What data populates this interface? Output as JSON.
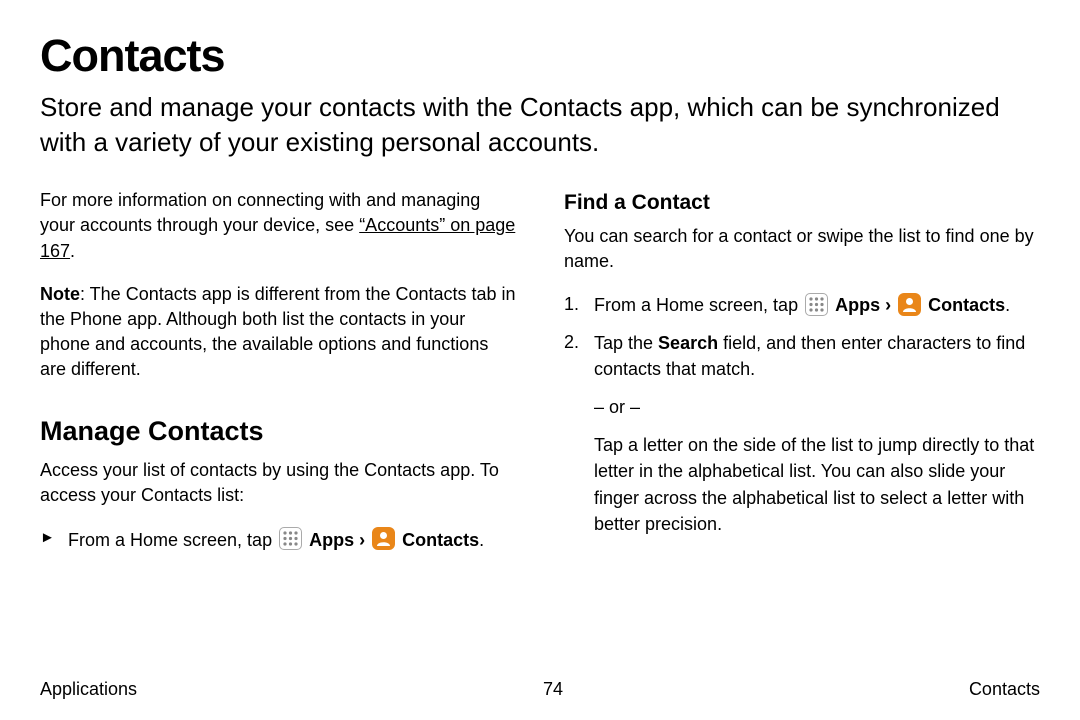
{
  "title": "Contacts",
  "intro": "Store and manage your contacts with the Contacts app, which can be synchronized with a variety of your existing personal accounts.",
  "left": {
    "info_prefix": "For more information on connecting with and managing your accounts through your device, see ",
    "info_link": "“Accounts” on page 167",
    "info_suffix": ".",
    "note_label": "Note",
    "note_body": ": The Contacts app is different from the Contacts tab in the Phone app. Although both list the contacts in your phone and accounts, the available options and functions are different.",
    "manage_heading": "Manage Contacts",
    "manage_body": "Access your list of contacts by using the Contacts app. To access your Contacts list:",
    "step_bullet": "►",
    "step_prefix": "From a Home screen, tap ",
    "apps_label": "Apps",
    "sep": " › ",
    "contacts_label": "Contacts",
    "period": "."
  },
  "right": {
    "find_heading": "Find a Contact",
    "find_body": "You can search for a contact or swipe the list to find one by name.",
    "step1_num": "1.",
    "step1_prefix": "From a Home screen, tap ",
    "step2_num": "2.",
    "step2_a": "Tap the ",
    "step2_search": "Search",
    "step2_b": " field, and then enter characters to find contacts that match.",
    "or_text": "– or –",
    "alt_body": "Tap a letter on the side of the list to jump directly to that letter in the alphabetical list. You can also slide your finger across the alphabetical list to select a letter with better precision."
  },
  "footer": {
    "left": "Applications",
    "center": "74",
    "right": "Contacts"
  },
  "icons": {
    "apps": "apps-grid-icon",
    "contacts": "contacts-person-icon"
  }
}
